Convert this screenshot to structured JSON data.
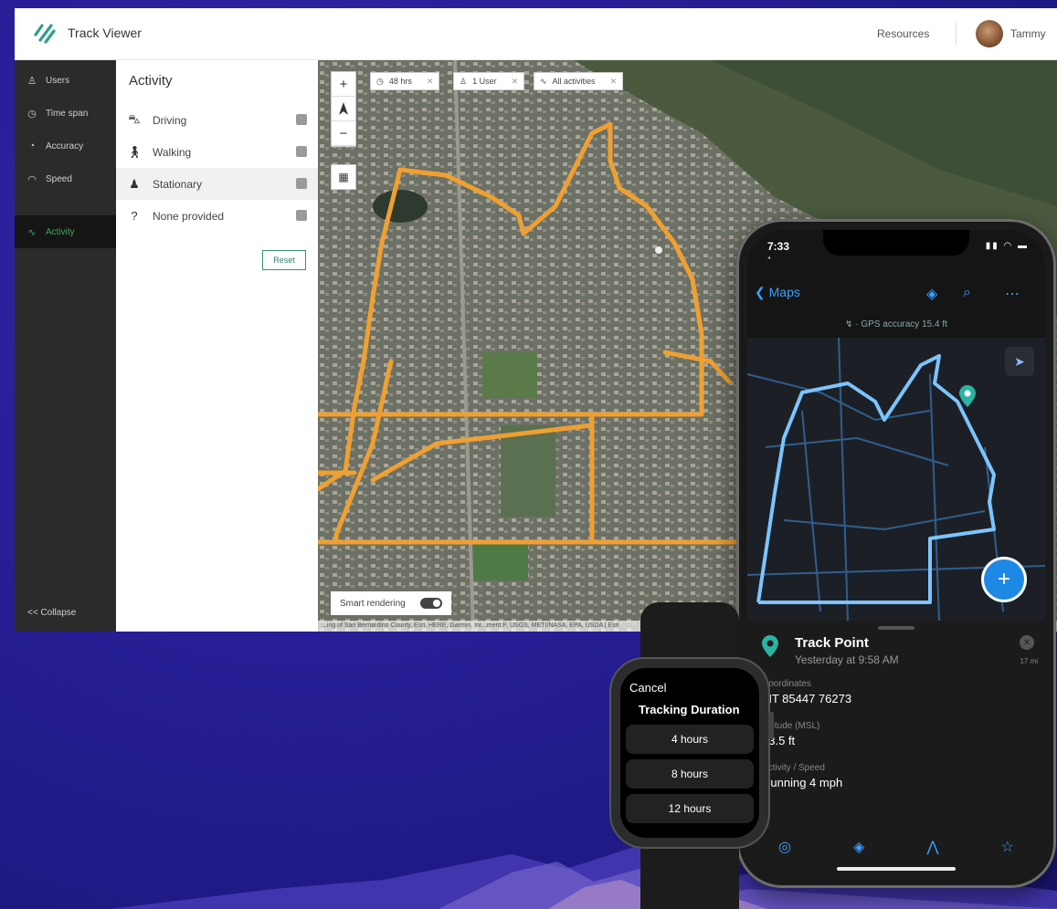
{
  "web": {
    "app_title": "Track Viewer",
    "resources": "Resources",
    "user_name": "Tammy",
    "nav": [
      {
        "label": "Users",
        "icon": "person-icon"
      },
      {
        "label": "Time span",
        "icon": "clock-icon"
      },
      {
        "label": "Accuracy",
        "icon": "signal-icon"
      },
      {
        "label": "Speed",
        "icon": "speedometer-icon"
      },
      {
        "label": "Activity",
        "icon": "activity-icon",
        "active": true
      }
    ],
    "collapse": "<< Collapse",
    "panel": {
      "title": "Activity",
      "items": [
        {
          "label": "Driving",
          "icon": "car-icon",
          "checked": true
        },
        {
          "label": "Walking",
          "icon": "walking-icon",
          "checked": true
        },
        {
          "label": "Stationary",
          "icon": "standing-icon",
          "checked": true,
          "highlighted": true
        },
        {
          "label": "None provided",
          "icon": "question-icon",
          "checked": true
        }
      ],
      "reset": "Reset"
    },
    "map": {
      "chips": [
        {
          "label": "48 hrs",
          "icon": "clock-icon"
        },
        {
          "label": "1 User",
          "icon": "person-icon"
        },
        {
          "label": "All activities",
          "icon": "activity-icon"
        }
      ],
      "smart_rendering": "Smart rendering",
      "smart_rendering_on": true,
      "attribution": "...ing of San Bernardino County, Esri, HERE, Garmin, Int...ment P, USGS, METI/NASA, EPA, USDA | Esri"
    }
  },
  "phone": {
    "time": "7:33",
    "back_label": "Maps",
    "gps_line": "GPS accuracy 15.4 ft",
    "track_point": {
      "title": "Track Point",
      "subtitle": "Yesterday at 9:58 AM",
      "side": "17 mi",
      "fields": [
        {
          "label": "Coordinates",
          "value": "MT 85447 76273"
        },
        {
          "label": "Altitude (MSL)",
          "value": "33.5 ft"
        },
        {
          "label": "Activity / Speed",
          "value": "Running 4 mph"
        }
      ]
    },
    "route_color": "#7cc4ff",
    "pin_color": "#2bb3a3"
  },
  "watch": {
    "cancel": "Cancel",
    "title": "Tracking Duration",
    "options": [
      "4 hours",
      "8 hours",
      "12 hours"
    ]
  },
  "colors": {
    "track_orange": "#f0a030",
    "accent_green": "#3ea65e",
    "brand_teal": "#2f9e8a"
  }
}
